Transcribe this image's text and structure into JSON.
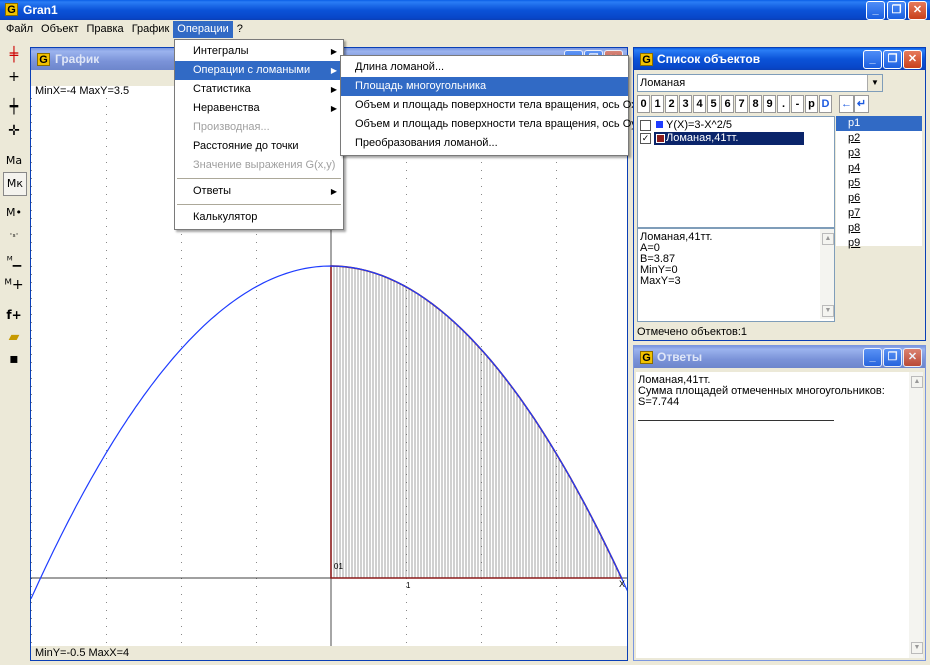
{
  "window": {
    "title": "Gran1"
  },
  "menubar": {
    "items": [
      "Файл",
      "Объект",
      "Правка",
      "График",
      "Операции",
      "?"
    ],
    "active_index": 4
  },
  "toolbar": {
    "icons": [
      "point-add-icon",
      "point-move-icon",
      "axis-icon",
      "cross-icon",
      "scale-a-icon",
      "scale-k-icon",
      "point-mark-icon",
      "points-icon",
      "minus-scale-icon",
      "plus-scale-icon",
      "add-function-icon",
      "open-file-icon",
      "save-icon"
    ],
    "labels": {
      "ma": "Ma",
      "mk": "Mк",
      "mdot": "M•",
      "fplus": "f+"
    }
  },
  "graph": {
    "title": "График",
    "top_status": "MinX=-4 MaxY=3.5",
    "bottom_status": "MinY=-0.5 MaxX=4",
    "origin_label": "01",
    "tick_1": "1",
    "x_label": "X",
    "colors": {
      "curve": "#1e3cff",
      "polygon": "#8b1a1a",
      "hatch": "#444444"
    }
  },
  "operations_menu": {
    "items": [
      {
        "label": "Интегралы",
        "submenu": true,
        "state": "normal"
      },
      {
        "label": "Операции с ломаными",
        "submenu": true,
        "state": "selected"
      },
      {
        "label": "Статистика",
        "submenu": true,
        "state": "normal"
      },
      {
        "label": "Неравенства",
        "submenu": true,
        "state": "normal"
      },
      {
        "label": "Производная...",
        "submenu": false,
        "state": "disabled"
      },
      {
        "label": "Расстояние до точки",
        "submenu": false,
        "state": "normal"
      },
      {
        "label": "Значение выражения G(x,y)",
        "submenu": false,
        "state": "disabled"
      },
      {
        "label": "Ответы",
        "submenu": true,
        "state": "normal"
      },
      {
        "label": "Калькулятор",
        "submenu": false,
        "state": "normal"
      }
    ]
  },
  "polyline_submenu": {
    "items": [
      {
        "label": "Длина ломаной...",
        "state": "normal"
      },
      {
        "label": "Площадь многоугольника",
        "state": "selected"
      },
      {
        "label": "Объем и площадь поверхности тела вращения, ось Ox",
        "state": "normal"
      },
      {
        "label": "Объем и площадь поверхности тела вращения, ось Oy",
        "state": "normal"
      },
      {
        "label": "Преобразования ломаной...",
        "state": "normal"
      }
    ]
  },
  "objects": {
    "title": "Список объектов",
    "dropdown_value": "Ломаная",
    "digit_buttons": [
      "0",
      "1",
      "2",
      "3",
      "4",
      "5",
      "6",
      "7",
      "8",
      "9",
      ".",
      "-",
      "p",
      "D"
    ],
    "list": [
      {
        "label": "Y(X)=3-X^2/5",
        "checked": false,
        "color": "#1e3cff",
        "selected": false
      },
      {
        "label": "Ломаная,41тт.",
        "checked": true,
        "color": "#8b1a1a",
        "selected": true
      }
    ],
    "params": [
      "p1",
      "p2",
      "p3",
      "p4",
      "p5",
      "p6",
      "p7",
      "p8",
      "p9"
    ],
    "info_lines": [
      "Ломаная,41тт.",
      "A=0",
      "B=3.87",
      "MinY=0",
      "MaxY=3"
    ],
    "status": "Отмечено объектов:1"
  },
  "answers": {
    "title": "Ответы",
    "lines": [
      "Ломаная,41тт.",
      "Сумма площадей отмеченных многоугольников:",
      "S=7.744"
    ]
  }
}
